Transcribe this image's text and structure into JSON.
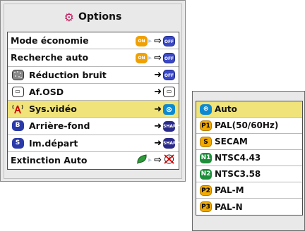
{
  "window": {
    "title": "Options",
    "items": [
      {
        "label": "Mode économie",
        "left_icon": "",
        "right": {
          "from": "ON",
          "to": "OFF"
        }
      },
      {
        "label": "Recherche auto",
        "left_icon": "",
        "right": {
          "from": "ON",
          "to": "OFF"
        }
      },
      {
        "label": "Réduction bruit",
        "left_icon": "noise-icon",
        "right": {
          "from": "",
          "to": "OFF"
        }
      },
      {
        "label": "Af.OSD",
        "left_icon": "osd-icon",
        "right": {
          "from": "",
          "to": "OSD"
        }
      },
      {
        "label": "Sys.vidéo",
        "left_icon": "antenna-icon",
        "right": {
          "from": "",
          "to": "AUTO"
        }
      },
      {
        "label": "Arrière-fond",
        "left_icon": "B",
        "right": {
          "from": "",
          "to": "SHARP"
        }
      },
      {
        "label": "Im.départ",
        "left_icon": "S",
        "right": {
          "from": "",
          "to": "SHARP"
        }
      },
      {
        "label": "Extinction Auto",
        "left_icon": "leaf-icon",
        "right": {
          "from": "",
          "to": "off-timer-icon"
        }
      }
    ],
    "selected_index": 4
  },
  "submenu": {
    "items": [
      {
        "badge": "⊛",
        "label": "Auto"
      },
      {
        "badge": "P1",
        "label": "PAL(50/60Hz)"
      },
      {
        "badge": "S",
        "label": "SECAM"
      },
      {
        "badge": "N1",
        "label": "NTSC4.43"
      },
      {
        "badge": "N2",
        "label": "NTSC3.58"
      },
      {
        "badge": "P2",
        "label": "PAL-M"
      },
      {
        "badge": "P3",
        "label": "PAL-N"
      }
    ],
    "selected_index": 0
  },
  "colors": {
    "highlight": "#efe37a",
    "on_badge": "#f0a000",
    "off_badge": "#3b49c8"
  }
}
